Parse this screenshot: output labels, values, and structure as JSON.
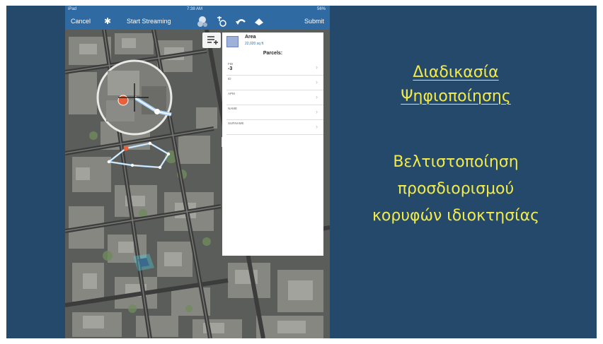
{
  "status_bar": {
    "device": "iPad",
    "time": "7:38 AM",
    "battery": "56%"
  },
  "toolbar": {
    "cancel_label": "Cancel",
    "stream_label": "Start Streaming",
    "submit_label": "Submit",
    "icons": [
      "gear-icon",
      "location-pin-icon",
      "gps-icon",
      "undo-icon",
      "eraser-icon"
    ]
  },
  "panel": {
    "feature_type": "Area",
    "area_value": "22,020 sq ft",
    "layer_title": "Parcels:",
    "fields": [
      {
        "label": "FID",
        "value": "-3"
      },
      {
        "label": "ID",
        "value": ""
      },
      {
        "label": "APM",
        "value": ""
      },
      {
        "label": "NAME",
        "value": ""
      },
      {
        "label": "SURNAME",
        "value": ""
      }
    ],
    "swatch_color": "#9db1d9"
  },
  "slide": {
    "title_lines": [
      "Διαδικασία",
      "Ψηφιοποίησης"
    ],
    "subtitle_lines": [
      "Βελτιστοποίηση",
      "προσδιορισμού",
      "κορυφών ιδιοκτησίας"
    ],
    "background_color": "#24496b",
    "text_color": "#f2ea4a"
  },
  "map": {
    "vertex_color": "#e8613a",
    "edit_line_color": "#a9d2f5",
    "highlight_color": "#4fd8e8"
  }
}
